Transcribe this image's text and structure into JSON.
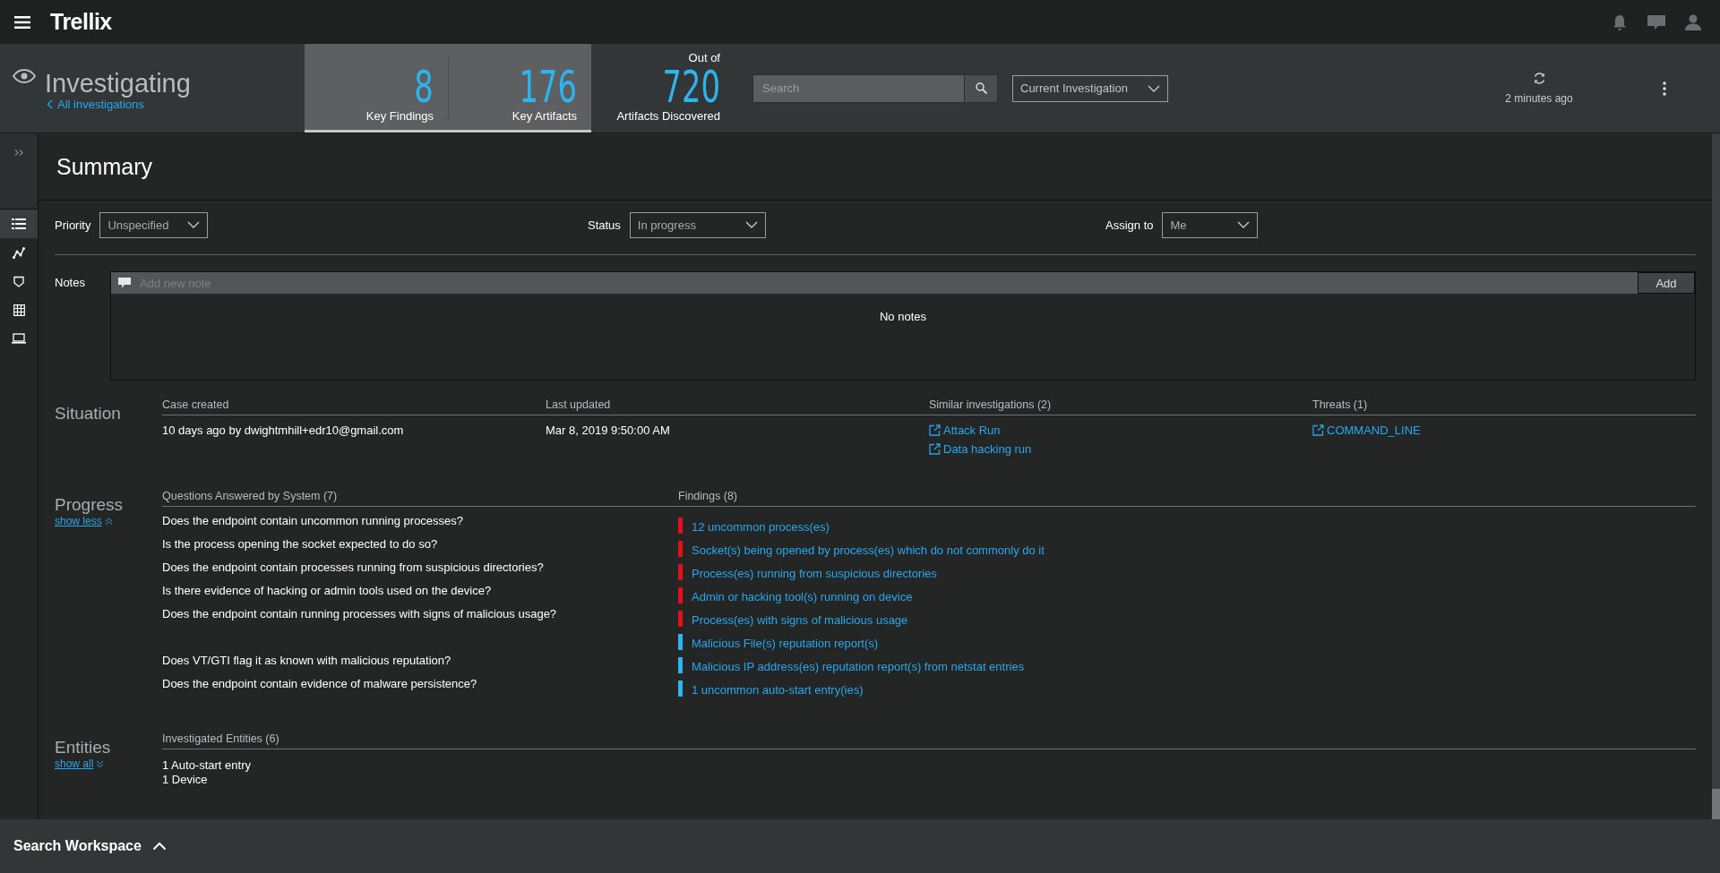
{
  "brand": "Trellix",
  "header": {
    "title": "Investigating",
    "back_link": "All investigations",
    "stats": [
      {
        "value": "8",
        "label": "Key Findings",
        "selected": true
      },
      {
        "value": "176",
        "label": "Key Artifacts",
        "selected": true
      },
      {
        "caption": "Out of",
        "value": "720",
        "label": "Artifacts Discovered",
        "selected": false
      }
    ],
    "search": {
      "placeholder": "Search"
    },
    "scope": "Current Investigation",
    "refreshed": "2 minutes ago"
  },
  "sidebar": {
    "items": [
      {
        "selected": true
      },
      {
        "selected": false
      },
      {
        "selected": false
      },
      {
        "selected": false
      },
      {
        "selected": false
      }
    ]
  },
  "page_title": "Summary",
  "fields": [
    {
      "label": "Priority",
      "value": "Unspecified"
    },
    {
      "label": "Status",
      "value": "In progress"
    },
    {
      "label": "Assign to",
      "value": "Me"
    }
  ],
  "notes": {
    "label": "Notes",
    "placeholder": "Add new note",
    "add_button": "Add",
    "empty_text": "No notes"
  },
  "situation": {
    "title": "Situation",
    "columns": [
      {
        "heading": "Case created",
        "kind": "text",
        "items": [
          "10 days ago by dwightmhill+edr10@gmail.com"
        ]
      },
      {
        "heading": "Last updated",
        "kind": "text",
        "items": [
          "Mar 8, 2019 9:50:00 AM"
        ]
      },
      {
        "heading": "Similar investigations (2)",
        "kind": "link",
        "items": [
          "Attack Run",
          "Data hacking run"
        ]
      },
      {
        "heading": "Threats (1)",
        "kind": "link",
        "items": [
          "COMMAND_LINE"
        ]
      }
    ]
  },
  "progress": {
    "title": "Progress",
    "toggle": "show less",
    "questions_heading": "Questions Answered by System (7)",
    "findings_heading": "Findings (8)",
    "rows": [
      {
        "question": "Does the endpoint contain uncommon running processes?",
        "finding": "12 uncommon process(es)",
        "color": "#e3101b"
      },
      {
        "question": "Is the process opening the socket expected to do so?",
        "finding": "Socket(s) being opened by process(es) which do not commonly do it",
        "color": "#e3101b"
      },
      {
        "question": "Does the endpoint contain processes running from suspicious directories?",
        "finding": "Process(es) running from suspicious directories",
        "color": "#e3101b"
      },
      {
        "question": "Is there evidence of hacking or admin tools used on the device?",
        "finding": "Admin or hacking tool(s) running on device",
        "color": "#e3101b"
      },
      {
        "question": "Does the endpoint contain running processes with signs of malicious usage?",
        "finding": "Process(es) with signs of malicious usage",
        "color": "#e3101b"
      },
      {
        "finding": "Malicious File(s) reputation report(s)",
        "color": "#2bb5ee"
      },
      {
        "question": "Does VT/GTI flag it as known with malicious reputation?",
        "finding": "Malicious IP address(es) reputation report(s) from netstat entries",
        "color": "#2bb5ee"
      },
      {
        "question": "Does the endpoint contain evidence of malware persistence?",
        "finding": "1 uncommon auto-start entry(ies)",
        "color": "#2bb5ee"
      }
    ]
  },
  "entities": {
    "title": "Entities",
    "toggle": "show all",
    "heading": "Investigated Entities (6)",
    "items": [
      "1 Auto-start entry",
      "1 Device"
    ]
  },
  "footer": {
    "label": "Search Workspace"
  }
}
